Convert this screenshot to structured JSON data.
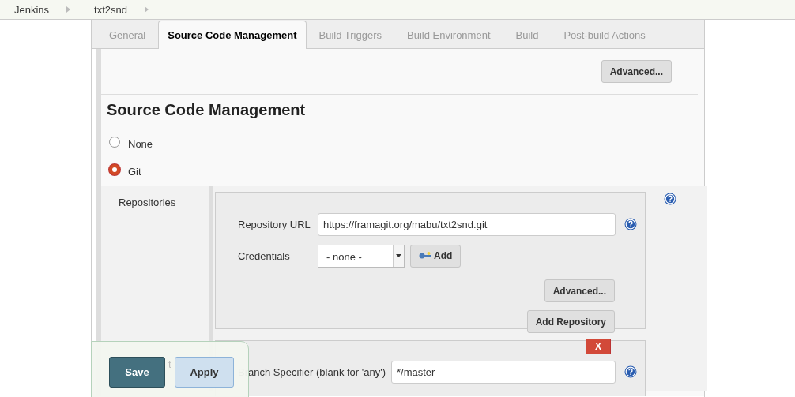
{
  "breadcrumbs": [
    {
      "label": "Jenkins"
    },
    {
      "label": "txt2snd"
    }
  ],
  "tabs": [
    {
      "label": "General",
      "selected": false
    },
    {
      "label": "Source Code Management",
      "selected": true
    },
    {
      "label": "Build Triggers",
      "selected": false
    },
    {
      "label": "Build Environment",
      "selected": false
    },
    {
      "label": "Build",
      "selected": false
    },
    {
      "label": "Post-build Actions",
      "selected": false
    }
  ],
  "advanced_button": "Advanced...",
  "section_title": "Source Code Management",
  "scm_options": [
    {
      "label": "None",
      "selected": false
    },
    {
      "label": "Git",
      "selected": true
    }
  ],
  "repositories": {
    "label": "Repositories",
    "url_label": "Repository URL",
    "url_value": "https://framagit.org/mabu/txt2snd.git",
    "credentials_label": "Credentials",
    "credentials_value": "- none -",
    "add_button": "Add",
    "advanced_button": "Advanced...",
    "add_repository_button": "Add Repository"
  },
  "branches": {
    "partial_label": "t",
    "delete_button": "X",
    "specifier_label": "Branch Specifier (blank for 'any')",
    "specifier_value": "*/master"
  },
  "footer": {
    "save": "Save",
    "apply": "Apply"
  }
}
